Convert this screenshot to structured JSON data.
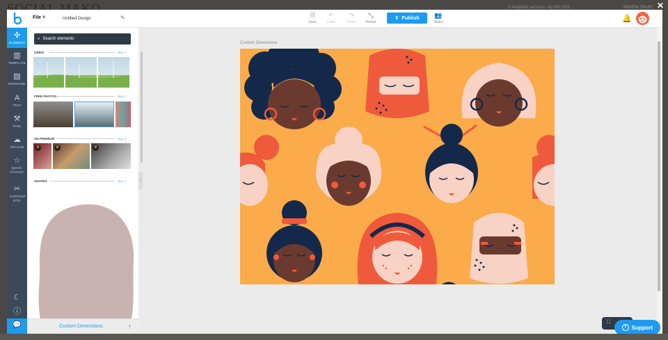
{
  "backdrop": {
    "brand": "SOCIAL MAKO",
    "top_text": "0 Amplified services, Up 0/6 1005",
    "user": "Martha South"
  },
  "topbar": {
    "file": "File ˅",
    "design_name": "Untitled Design",
    "tools": [
      {
        "id": "save",
        "label": "Save",
        "icon": "save-icon",
        "glyph": "🗎",
        "disabled": false
      },
      {
        "id": "undo",
        "label": "Undo",
        "icon": "undo-icon",
        "glyph": "↶",
        "disabled": true
      },
      {
        "id": "redo",
        "label": "Redo",
        "icon": "redo-icon",
        "glyph": "↷",
        "disabled": true
      },
      {
        "id": "resize",
        "label": "Resize",
        "icon": "resize-icon",
        "glyph": "⤡",
        "disabled": false
      }
    ],
    "publish": "Publish",
    "share": "Share"
  },
  "rail": [
    {
      "id": "element",
      "label": "ELEMENT",
      "icon": "shapes-icon",
      "glyph": "✣",
      "active": true
    },
    {
      "id": "template",
      "label": "TEMPLATE",
      "icon": "template-icon",
      "glyph": "▥",
      "active": false
    },
    {
      "id": "bground",
      "label": "BGROUND",
      "icon": "background-icon",
      "glyph": "▧",
      "active": false
    },
    {
      "id": "text",
      "label": "TEXT",
      "icon": "text-icon",
      "glyph": "A",
      "active": false
    },
    {
      "id": "tool",
      "label": "TOOL",
      "icon": "wrench-icon",
      "glyph": "🔧",
      "active": false
    },
    {
      "id": "upload",
      "label": "UPLOAD",
      "icon": "upload-cloud-icon",
      "glyph": "☁",
      "active": false
    },
    {
      "id": "quick-access",
      "label": "QUICK ACCESS",
      "icon": "star-icon",
      "glyph": "☆",
      "active": false
    },
    {
      "id": "content-kits",
      "label": "CONTENT KITS",
      "icon": "kits-icon",
      "glyph": "✂",
      "active": false
    }
  ],
  "panel": {
    "search_placeholder": "Search elements",
    "sections": [
      {
        "id": "grids",
        "title": "GRIDS",
        "all": "ALL >"
      },
      {
        "id": "free-photos",
        "title": "FREE PHOTOS",
        "all": "ALL >"
      },
      {
        "id": "sm-premium",
        "title": "SM PREMIUM",
        "all": "ALL >"
      },
      {
        "id": "shapes",
        "title": "SHAPES",
        "all": "ALL >"
      }
    ],
    "footer_link": "Custom Dimensions"
  },
  "canvas": {
    "label": "Custom Dimensions"
  },
  "support": "Support",
  "colors": {
    "accent": "#1d9bf0",
    "rail": "#3b4a58",
    "canvas": "#fbab4a",
    "shape": "#c8b3b1"
  }
}
